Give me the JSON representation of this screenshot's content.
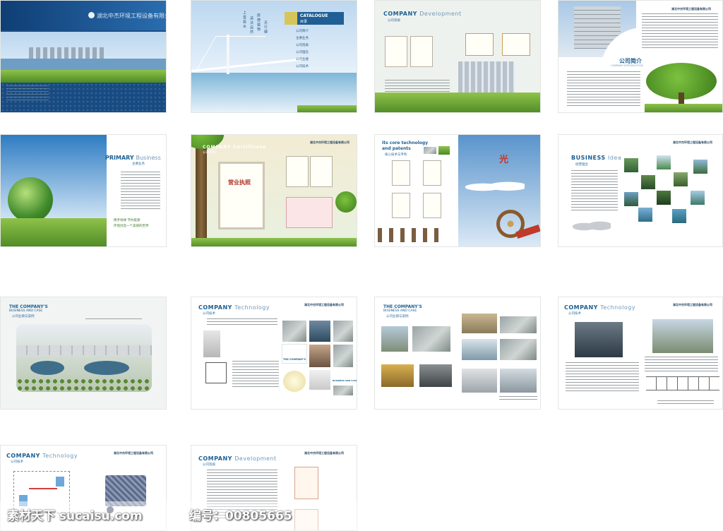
{
  "company_name": "湖北中杰环境工程设备有限公司",
  "p1": {
    "cover_name": "湖北中杰环境工程设备有限公司"
  },
  "p2": {
    "catalogue_en": "CATALOGUE",
    "catalogue_cn": "目录",
    "toc": [
      "公司简介",
      "主要业务",
      "公司资质",
      "公司理念",
      "公司业绩",
      "公司技术"
    ],
    "poem": [
      "上 善 若 水",
      "道 法 自 然",
      "厚 德 载 物",
      "天 行 健"
    ]
  },
  "p3": {
    "title_bold": "COMPANY",
    "title_light": "Development",
    "subtitle": "公司资质"
  },
  "p4": {
    "title": "公司简介",
    "subtitle": "COMPANY INTRODUCTION"
  },
  "p5": {
    "title_bold": "PRIMARY",
    "title_light": "Business",
    "subtitle": "主要业务",
    "slogan": [
      "携手地球 节约能源",
      "环境创造一个美丽的世界"
    ]
  },
  "p6": {
    "title_bold": "COMPANY",
    "title_light": "Certificate",
    "subtitle": "公司资质",
    "license": "营业执照"
  },
  "p7": {
    "title": [
      "Its core technology",
      "and patents"
    ],
    "subtitle": "核心技术与专利",
    "char": "光"
  },
  "p8": {
    "title_bold": "BUSINESS",
    "title_light": "Idea",
    "subtitle": "经营理念"
  },
  "p9": {
    "title": [
      "THE COMPANY'S",
      "BUSINESS AND CASE"
    ],
    "subtitle": "公司业绩与案例"
  },
  "p10": {
    "title_bold": "COMPANY",
    "title_light": "Technology",
    "subtitle": "公司技术",
    "label1": "THE COMPANY'S",
    "label2": "BUSINESS AND CASE"
  },
  "p11": {
    "title": [
      "THE COMPANY'S",
      "BUSINESS AND CASE"
    ],
    "subtitle": "公司业绩与案例"
  },
  "p12": {
    "title_bold": "COMPANY",
    "title_light": "Technology",
    "subtitle": "公司技术"
  },
  "p13": {
    "title_bold": "COMPANY",
    "title_light": "Technology",
    "subtitle": "公司技术"
  },
  "p14": {
    "title_bold": "COMPANY",
    "title_light": "Development",
    "subtitle": "公司资质"
  },
  "watermark": {
    "site": "素材天下 sucaisu.com",
    "id_label": "编号：",
    "id": "00805665"
  }
}
